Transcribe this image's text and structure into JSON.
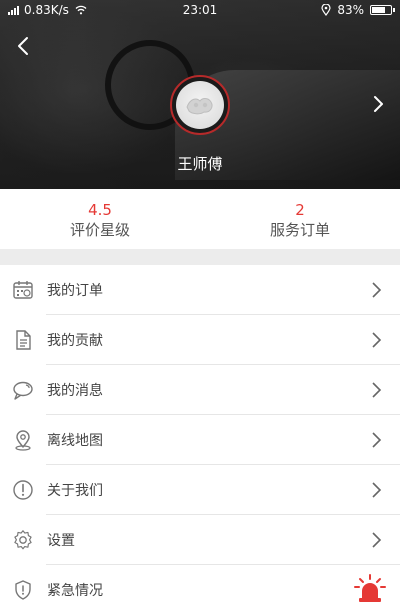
{
  "status_bar": {
    "network_speed": "0.83K/s",
    "time": "23:01",
    "battery": "83%",
    "battery_level": 0.83
  },
  "header": {
    "driver_name": "王师傅"
  },
  "stats": [
    {
      "value": "4.5",
      "label": "评价星级"
    },
    {
      "value": "2",
      "label": "服务订单"
    }
  ],
  "menu": {
    "items": [
      {
        "label": "我的订单",
        "icon": "calendar-icon"
      },
      {
        "label": "我的贡献",
        "icon": "document-icon"
      },
      {
        "label": "我的消息",
        "icon": "chat-bubble-icon"
      },
      {
        "label": "离线地图",
        "icon": "location-pin-icon"
      },
      {
        "label": "关于我们",
        "icon": "info-icon"
      },
      {
        "label": "设置",
        "icon": "gear-icon"
      },
      {
        "label": "紧急情况",
        "icon": "shield-icon"
      }
    ]
  },
  "colors": {
    "accent": "#e53935",
    "alarm": "#e53935"
  }
}
